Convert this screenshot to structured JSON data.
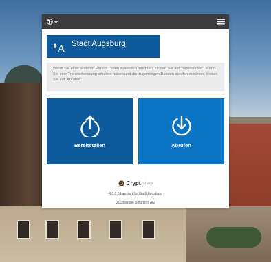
{
  "header": {
    "language_icon": "globe-icon",
    "menu_icon": "hamburger-icon"
  },
  "logo": {
    "text": "Stadt Augsburg",
    "letter": "A"
  },
  "info": {
    "text": "Wenn Sie einer anderen Person Daten zusenden möchten, klicken Sie auf 'Bereitstellen'. Wenn Sie eine Transferkennung erhalten haben und die zugehörigen Dateien abrufen möchten, klicken Sie auf 'Abrufen'."
  },
  "tiles": {
    "upload_label": "Bereitstellen",
    "download_label": "Abrufen"
  },
  "footer": {
    "brand": "Crypt",
    "brand_suffix": "share",
    "version": "4.0.0.0 baestart für Stadt Augsburg",
    "copyright": "2018 beline Solutions AG"
  },
  "colors": {
    "topbar": "#3b3b3b",
    "logo_bg": "#0e5a9a",
    "upload_tile": "#0e5a9a",
    "download_tile": "#0b75c4"
  }
}
